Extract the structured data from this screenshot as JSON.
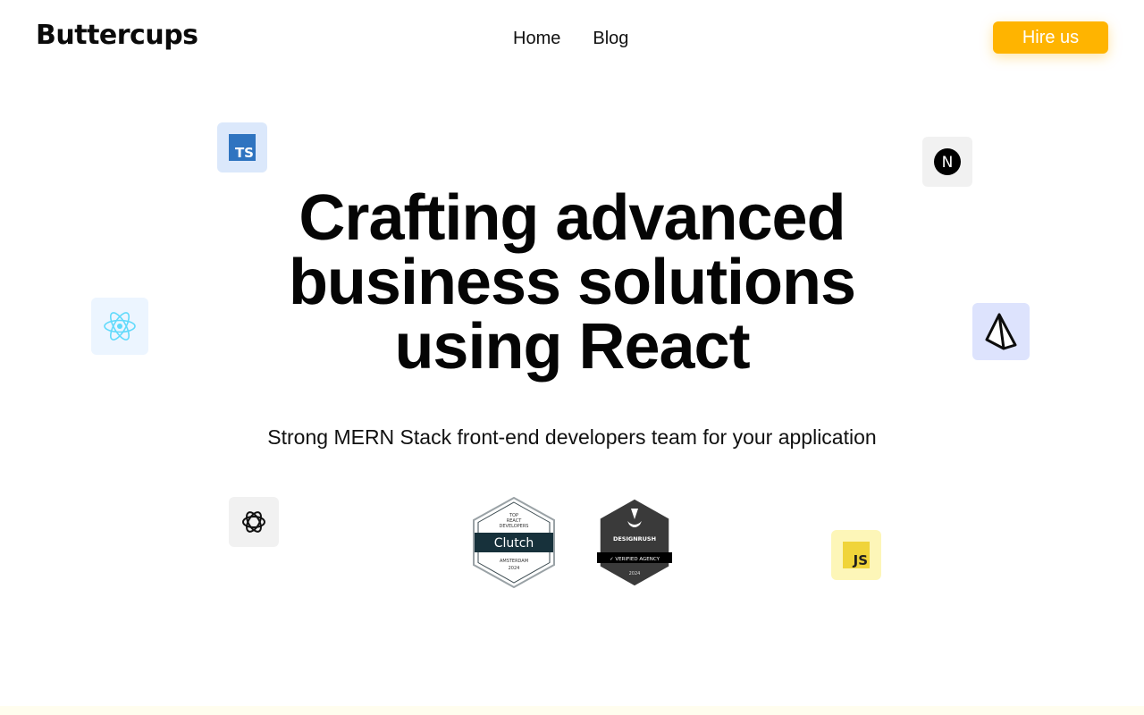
{
  "header": {
    "logo": "Buttercups",
    "nav": [
      {
        "label": "Home"
      },
      {
        "label": "Blog"
      }
    ],
    "cta_label": "Hire us"
  },
  "hero": {
    "title_lines": [
      "Crafting advanced",
      "business solutions",
      "using React"
    ],
    "subtitle": "Strong MERN Stack front-end developers team for your application"
  },
  "tech_icons": [
    {
      "name": "typescript-icon",
      "text": "TS"
    },
    {
      "name": "nextjs-icon",
      "text": "N"
    },
    {
      "name": "react-icon"
    },
    {
      "name": "prisma-icon"
    },
    {
      "name": "openai-icon"
    },
    {
      "name": "javascript-icon",
      "text": "JS"
    }
  ],
  "badges": {
    "clutch": {
      "top": "TOP",
      "line1": "REACT",
      "line2": "DEVELOPERS",
      "brand": "Clutch",
      "location": "AMSTERDAM",
      "year": "2024"
    },
    "designrush": {
      "brand": "DESIGNRUSH",
      "ribbon": "✓ VERIFIED AGENCY",
      "year": "2024"
    }
  },
  "colors": {
    "accent": "#ffb400",
    "react": "#61dafb",
    "typescript": "#2f74c0",
    "javascript": "#f0d43a"
  }
}
